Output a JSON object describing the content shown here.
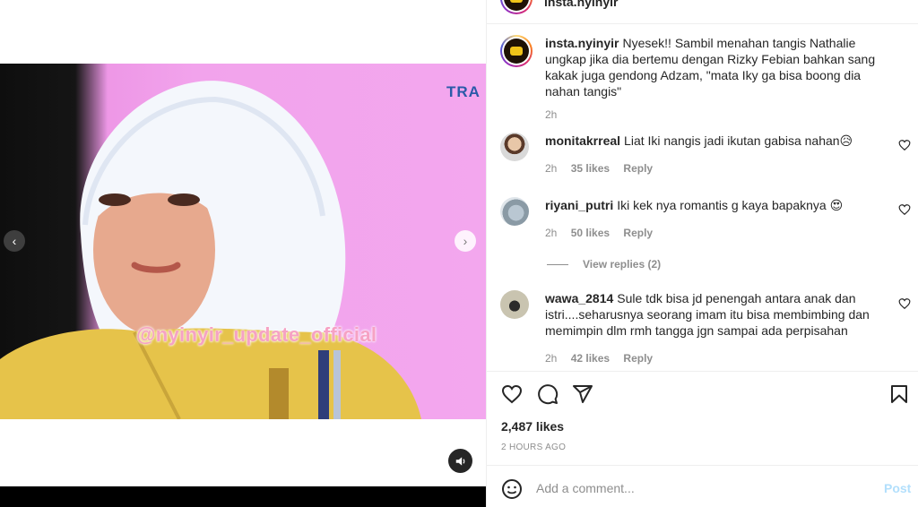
{
  "header": {
    "username": "insta.nyinyir"
  },
  "media": {
    "channel_logo": "TRA",
    "watermark": "@nyinyir_update_official",
    "prev_icon": "chevron-left-icon",
    "next_icon": "chevron-right-icon",
    "mute_icon": "speaker-icon"
  },
  "caption": {
    "username": "insta.nyinyir",
    "text": "Nyesek!! Sambil menahan tangis Nathalie ungkap jika dia bertemu dengan Rizky Febian bahkan sang kakak juga gendong Adzam, \"mata Iky ga bisa boong dia nahan tangis\"",
    "time": "2h"
  },
  "comments": [
    {
      "username": "monitakrreal",
      "text": "Liat Iki nangis jadi ikutan gabisa nahan😥",
      "time": "2h",
      "likes": "35 likes",
      "reply": "Reply"
    },
    {
      "username": "riyani_putri",
      "text": "Iki kek nya romantis g kaya bapaknya 😍",
      "time": "2h",
      "likes": "50 likes",
      "reply": "Reply"
    },
    {
      "username": "wawa_2814",
      "text": "Sule tdk bisa jd penengah antara anak dan istri....seharusnya seorang imam itu bisa membimbing dan memimpin dlm rmh tangga jgn sampai ada perpisahan",
      "time": "2h",
      "likes": "42 likes",
      "reply": "Reply"
    }
  ],
  "view_replies": "View replies (2)",
  "actions": {
    "like_icon": "heart-icon",
    "comment_icon": "comment-icon",
    "share_icon": "paper-plane-icon",
    "save_icon": "bookmark-icon"
  },
  "likes": "2,487 likes",
  "timeago": "2 HOURS AGO",
  "add_comment": {
    "placeholder": "Add a comment...",
    "post_label": "Post"
  },
  "colors": {
    "accent": "#0095f6",
    "post_disabled": "#b2dffc",
    "text": "#262626",
    "muted": "#8e8e8e"
  }
}
